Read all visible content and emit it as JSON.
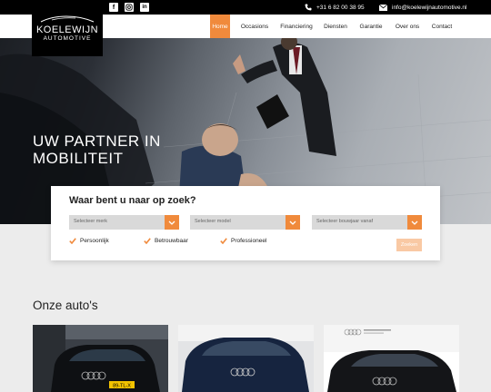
{
  "topbar": {
    "phone": "+31 6 82 00 38 95",
    "email": "info@koelewijnautomotive.nl",
    "social": [
      "facebook-icon",
      "instagram-icon",
      "linkedin-icon"
    ]
  },
  "logo": {
    "main": "KOELEWIJN",
    "sub": "AUTOMOTIVE"
  },
  "nav": {
    "items": [
      {
        "label": "Home",
        "active": true
      },
      {
        "label": "Occasions"
      },
      {
        "label": "Financiering"
      },
      {
        "label": "Diensten"
      },
      {
        "label": "Garantie"
      },
      {
        "label": "Over ons"
      },
      {
        "label": "Contact"
      }
    ]
  },
  "hero": {
    "title": "UW PARTNER IN MOBILITEIT"
  },
  "search": {
    "title": "Waar bent u naar op zoek?",
    "selects": [
      {
        "placeholder": "Selecteer merk"
      },
      {
        "placeholder": "Selecteer model"
      },
      {
        "placeholder": "Selecteer bouwjaar vanaf"
      }
    ],
    "usps": [
      "Persoonlijk",
      "Betrouwbaar",
      "Professioneel"
    ],
    "button_label": "Zoeken"
  },
  "cars": {
    "title": "Onze auto's",
    "cards": [
      {
        "image": "black-audi-hatchback",
        "plate": "89-TL-X"
      },
      {
        "image": "blue-audi-sedan"
      },
      {
        "image": "black-audi-a4-avant"
      }
    ]
  },
  "colors": {
    "accent": "#f08a3c",
    "dark": "#000000",
    "page_bg": "#ececec"
  }
}
